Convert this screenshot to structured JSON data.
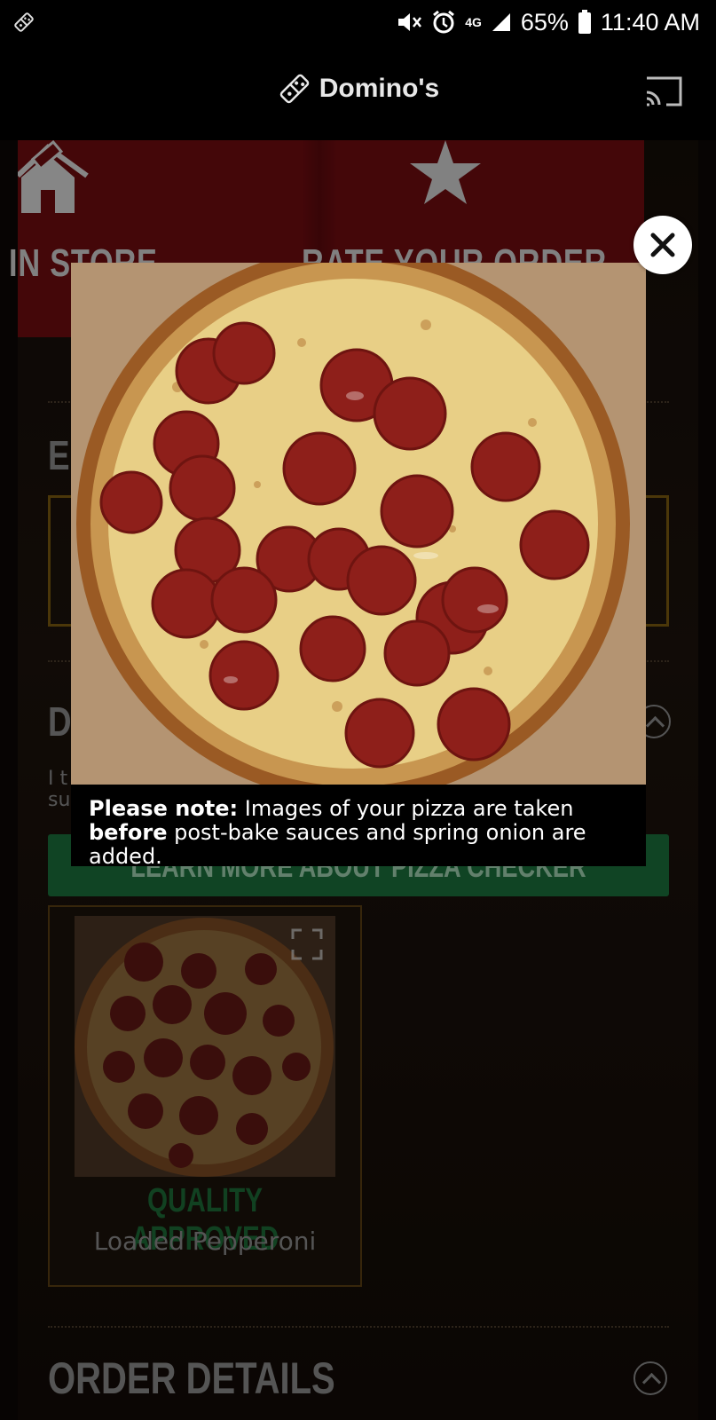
{
  "status_bar": {
    "network": "4G",
    "battery": "65%",
    "time": "11:40 AM"
  },
  "app_bar": {
    "title": "Domino's"
  },
  "background": {
    "tiles": [
      {
        "label": "IN STORE",
        "icon": "home-icon"
      },
      {
        "label": "RATE YOUR ORDER",
        "icon": "star-icon"
      }
    ],
    "section_initial_1": "E",
    "section_initial_2": "D",
    "small_text_line1": "I t",
    "small_text_line2": "su",
    "learn_button": "LEARN MORE ABOUT PIZZA CHECKER",
    "card": {
      "status": "QUALITY APPROVED",
      "product": "Loaded Pepperoni"
    },
    "order_details": "ORDER DETAILS"
  },
  "modal": {
    "note_bold_1": "Please note:",
    "note_text_1": " Images of your pizza are taken ",
    "note_bold_2": "before",
    "note_text_2": " post-bake sauces and spring onion are added."
  },
  "colors": {
    "brand_red": "#6e0c10",
    "approved_green": "#1c6a36",
    "button_green": "#1a6e3a"
  }
}
